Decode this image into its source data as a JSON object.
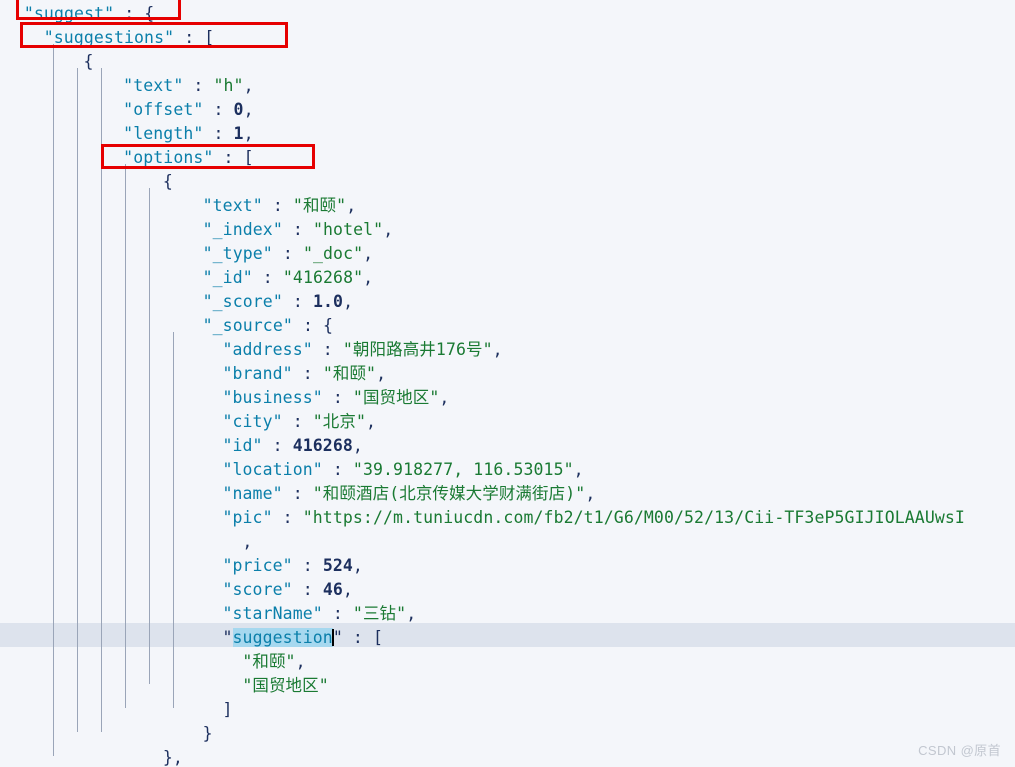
{
  "editor": {
    "background_color": "#f4f6fa",
    "current_line_highlight_color": "#dde3ed",
    "selection_color": "#a6d8ef",
    "key_color": "#0b7faa",
    "string_color": "#1a7a33",
    "number_color": "#1c2f5e",
    "annotation_color": "#e60000",
    "indent_guide_color": "#9aa5b8"
  },
  "code_lines": [
    {
      "indent": "  ",
      "key": "\"suggest\"",
      "sep": " : ",
      "value": "{",
      "kind": "brace"
    },
    {
      "indent": "    ",
      "key": "\"suggestions\"",
      "sep": " : ",
      "value": "[",
      "kind": "brace"
    },
    {
      "indent": "        ",
      "key": "",
      "sep": "",
      "value": "{",
      "kind": "brace"
    },
    {
      "indent": "            ",
      "key": "\"text\"",
      "sep": " : ",
      "value": "\"h\"",
      "kind": "string",
      "trail": ","
    },
    {
      "indent": "            ",
      "key": "\"offset\"",
      "sep": " : ",
      "value": "0",
      "kind": "number",
      "trail": ","
    },
    {
      "indent": "            ",
      "key": "\"length\"",
      "sep": " : ",
      "value": "1",
      "kind": "number",
      "trail": ","
    },
    {
      "indent": "            ",
      "key": "\"options\"",
      "sep": " : ",
      "value": "[",
      "kind": "brace"
    },
    {
      "indent": "                ",
      "key": "",
      "sep": "",
      "value": "{",
      "kind": "brace"
    },
    {
      "indent": "                    ",
      "key": "\"text\"",
      "sep": " : ",
      "value": "\"和颐\"",
      "kind": "string",
      "trail": ","
    },
    {
      "indent": "                    ",
      "key": "\"_index\"",
      "sep": " : ",
      "value": "\"hotel\"",
      "kind": "string",
      "trail": ","
    },
    {
      "indent": "                    ",
      "key": "\"_type\"",
      "sep": " : ",
      "value": "\"_doc\"",
      "kind": "string",
      "trail": ","
    },
    {
      "indent": "                    ",
      "key": "\"_id\"",
      "sep": " : ",
      "value": "\"416268\"",
      "kind": "string",
      "trail": ","
    },
    {
      "indent": "                    ",
      "key": "\"_score\"",
      "sep": " : ",
      "value": "1.0",
      "kind": "number",
      "trail": ","
    },
    {
      "indent": "                    ",
      "key": "\"_source\"",
      "sep": " : ",
      "value": "{",
      "kind": "brace"
    },
    {
      "indent": "                      ",
      "key": "\"address\"",
      "sep": " : ",
      "value": "\"朝阳路高井176号\"",
      "kind": "string",
      "trail": ","
    },
    {
      "indent": "                      ",
      "key": "\"brand\"",
      "sep": " : ",
      "value": "\"和颐\"",
      "kind": "string",
      "trail": ","
    },
    {
      "indent": "                      ",
      "key": "\"business\"",
      "sep": " : ",
      "value": "\"国贸地区\"",
      "kind": "string",
      "trail": ","
    },
    {
      "indent": "                      ",
      "key": "\"city\"",
      "sep": " : ",
      "value": "\"北京\"",
      "kind": "string",
      "trail": ","
    },
    {
      "indent": "                      ",
      "key": "\"id\"",
      "sep": " : ",
      "value": "416268",
      "kind": "number",
      "trail": ","
    },
    {
      "indent": "                      ",
      "key": "\"location\"",
      "sep": " : ",
      "value": "\"39.918277, 116.53015\"",
      "kind": "string",
      "trail": ","
    },
    {
      "indent": "                      ",
      "key": "\"name\"",
      "sep": " : ",
      "value": "\"和颐酒店(北京传媒大学财满街店)\"",
      "kind": "string",
      "trail": ","
    },
    {
      "indent": "                      ",
      "key": "\"pic\"",
      "sep": " : ",
      "value": "\"https://m.tuniucdn.com/fb2/t1/G6/M00/52/13/Cii-TF3eP5GIJIOLAAUwsI",
      "kind": "string",
      "trail": ""
    },
    {
      "indent": "                        ",
      "key": "",
      "sep": "",
      "value": "",
      "kind": "plain",
      "trail": ","
    },
    {
      "indent": "                      ",
      "key": "\"price\"",
      "sep": " : ",
      "value": "524",
      "kind": "number",
      "trail": ","
    },
    {
      "indent": "                      ",
      "key": "\"score\"",
      "sep": " : ",
      "value": "46",
      "kind": "number",
      "trail": ","
    },
    {
      "indent": "                      ",
      "key": "\"starName\"",
      "sep": " : ",
      "value": "\"三钻\"",
      "kind": "string",
      "trail": ","
    },
    {
      "indent": "                      ",
      "key": "\"suggestion\"",
      "sep": " : ",
      "value": "[",
      "kind": "brace",
      "selected": true,
      "caret": true
    },
    {
      "indent": "                        ",
      "key": "",
      "sep": "",
      "value": "\"和颐\"",
      "kind": "string",
      "trail": ","
    },
    {
      "indent": "                        ",
      "key": "",
      "sep": "",
      "value": "\"国贸地区\"",
      "kind": "string",
      "trail": ""
    },
    {
      "indent": "                      ",
      "key": "",
      "sep": "",
      "value": "]",
      "kind": "brace"
    },
    {
      "indent": "                    ",
      "key": "",
      "sep": "",
      "value": "}",
      "kind": "brace"
    },
    {
      "indent": "                ",
      "key": "",
      "sep": "",
      "value": "}",
      "kind": "brace",
      "trail": ","
    }
  ],
  "annotations": [
    {
      "label": "annotation-suggest"
    },
    {
      "label": "annotation-suggestions"
    },
    {
      "label": "annotation-options"
    }
  ],
  "watermark": {
    "text": "CSDN @原首"
  }
}
